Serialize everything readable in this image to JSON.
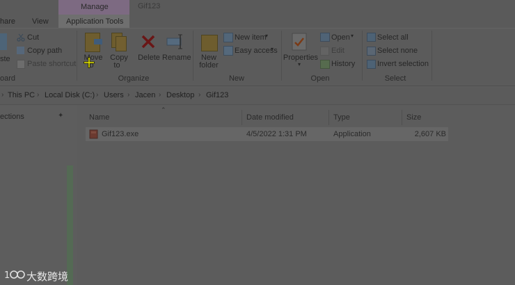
{
  "window": {
    "title": "Gif123"
  },
  "tabs": {
    "share": "hare",
    "view": "View",
    "manage": "Manage",
    "app_tools": "Application Tools"
  },
  "clipboard": {
    "paste": "ste",
    "cut": "Cut",
    "copy_path": "Copy path",
    "paste_shortcut": "Paste shortcut",
    "group": "oard"
  },
  "organize": {
    "move_to_1": "Move",
    "move_to_2": "to",
    "copy_to_1": "Copy",
    "copy_to_2": "to",
    "delete": "Delete",
    "rename": "Rename",
    "group": "Organize"
  },
  "new": {
    "new_folder_1": "New",
    "new_folder_2": "folder",
    "new_item": "New item",
    "easy_access": "Easy access",
    "group": "New"
  },
  "open": {
    "properties": "Properties",
    "open": "Open",
    "edit": "Edit",
    "history": "History",
    "group": "Open"
  },
  "select": {
    "select_all": "Select all",
    "select_none": "Select none",
    "invert": "Invert selection",
    "group": "Select"
  },
  "breadcrumb": [
    "This PC",
    "Local Disk (C:)",
    "Users",
    "Jacen",
    "Desktop",
    "Gif123"
  ],
  "nav": {
    "quick_access": "ections"
  },
  "columns": {
    "name": "Name",
    "date": "Date modified",
    "type": "Type",
    "size": "Size"
  },
  "files": [
    {
      "name": "Gif123.exe",
      "date": "4/5/2022 1:31 PM",
      "type": "Application",
      "size": "2,607 KB"
    }
  ],
  "watermark": "大数跨境",
  "colors": {
    "overlay": "#5c5c5c",
    "manage_tab": "#7d6a82",
    "cursor": "#e6e600"
  }
}
